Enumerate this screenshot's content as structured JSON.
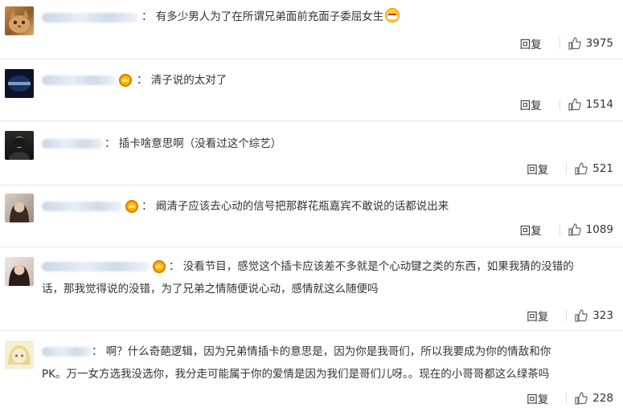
{
  "comments": [
    {
      "text": "：  有多少男人为了在所谓兄弟面前充面子委屈女生",
      "reply": "回复",
      "likes": "3975",
      "emoji": "grimacing-face",
      "crown": false
    },
    {
      "text": "：  清子说的太对了",
      "reply": "回复",
      "likes": "1514",
      "crown": true
    },
    {
      "text": "：  插卡啥意思啊（没看过这个综艺）",
      "reply": "回复",
      "likes": "521",
      "crown": false
    },
    {
      "text": "：  阚清子应该去心动的信号把那群花瓶嘉宾不敢说的话都说出来",
      "reply": "回复",
      "likes": "1089",
      "crown": true
    },
    {
      "text_line1": "：  没看节目，感觉这个插卡应该差不多就是个心动键之类的东西，如果我猜的没错的",
      "text_line2": "话，那我觉得说的没错，为了兄弟之情随便说心动，感情就这么随便吗",
      "reply": "回复",
      "likes": "323",
      "crown": true
    },
    {
      "text_line1": "：  啊？什么奇葩逻辑，因为兄弟情插卡的意思是，因为你是我哥们，所以我要成为你的情敌和你",
      "text_line2": "PK。万一女方选我没选你，我分走可能属于你的爱情是因为我们是哥们儿呀。。现在的小哥哥都这么绿茶吗",
      "reply": "回复",
      "likes": "228",
      "crown": false
    }
  ],
  "colors": {
    "text": "#333333",
    "divider": "#e6e6e6",
    "name_blur": "#c9d6e6"
  }
}
